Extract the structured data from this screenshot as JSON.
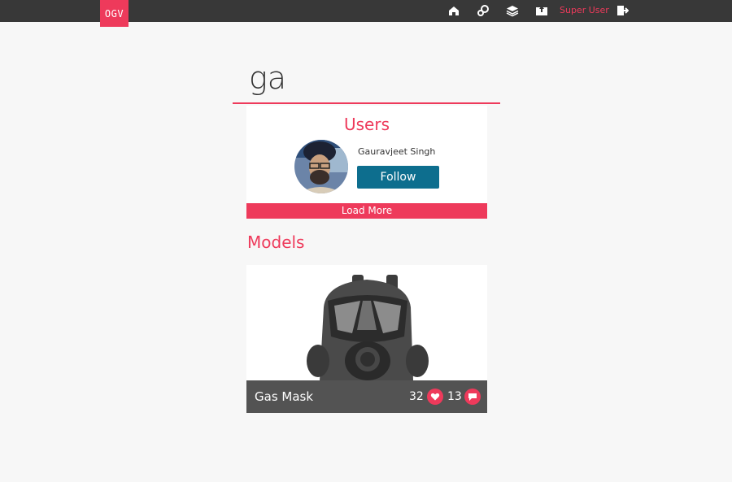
{
  "header": {
    "logo_text": "OGV",
    "user_name": "Super User",
    "icons": [
      "home-icon",
      "settings-icon",
      "layers-icon",
      "upload-icon",
      "logout-icon"
    ]
  },
  "search": {
    "value": "ga"
  },
  "users": {
    "title": "Users",
    "items": [
      {
        "name": "Gauravjeet Singh",
        "follow_label": "Follow"
      }
    ],
    "load_more_label": "Load More"
  },
  "models": {
    "title": "Models",
    "items": [
      {
        "name": "Gas Mask",
        "likes": "32",
        "comments": "13"
      }
    ]
  },
  "colors": {
    "accent": "#ee3a5b",
    "topbar": "#383838",
    "follow_button": "#0d6e8e",
    "model_footer": "#535353"
  }
}
